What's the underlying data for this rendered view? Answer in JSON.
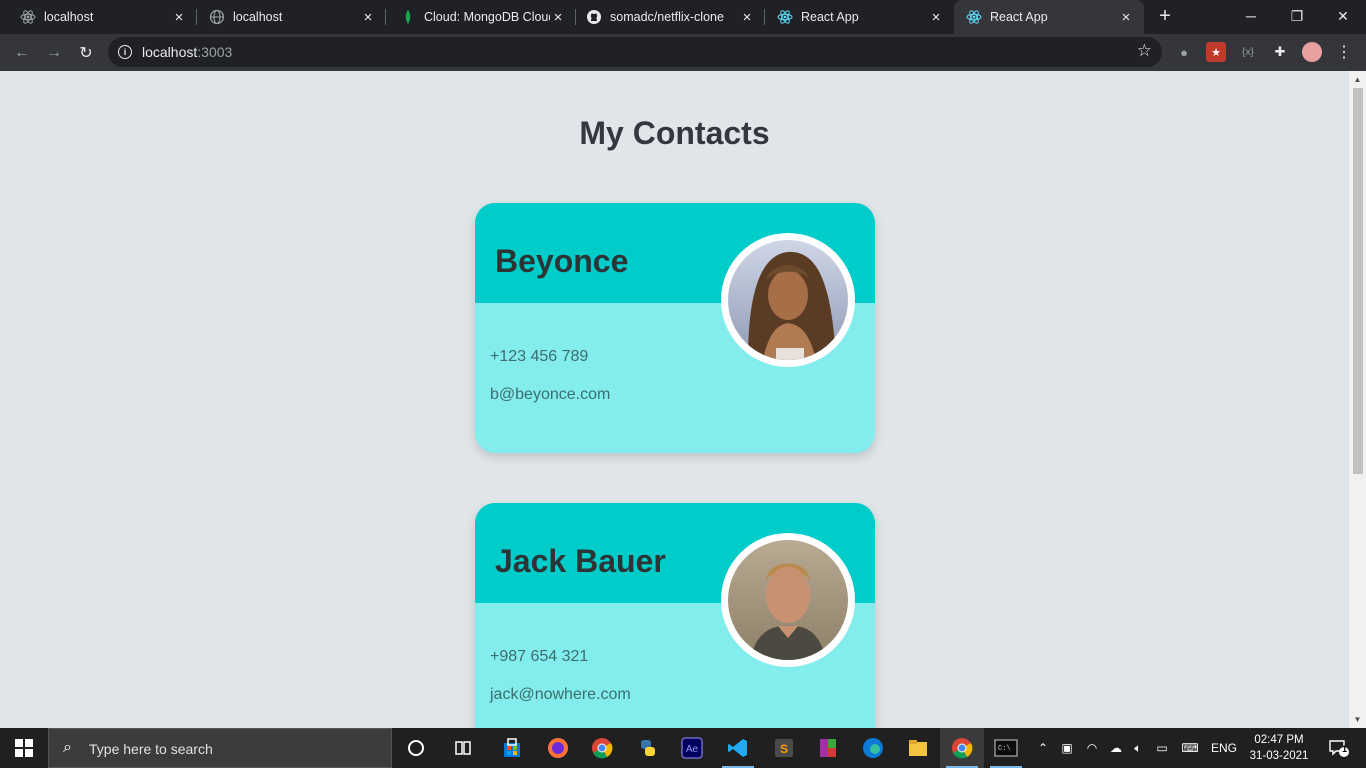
{
  "browser": {
    "tabs": [
      {
        "label": "localhost",
        "icon": "react-icon"
      },
      {
        "label": "localhost",
        "icon": "globe-icon"
      },
      {
        "label": "Cloud: MongoDB Cloud",
        "icon": "mongodb-leaf-icon"
      },
      {
        "label": "somadc/netflix-clone",
        "icon": "github-icon"
      },
      {
        "label": "React App",
        "icon": "react-icon"
      },
      {
        "label": "React App",
        "icon": "react-icon"
      }
    ],
    "active_tab_index": 5,
    "url_host": "localhost",
    "url_port": ":3003"
  },
  "page": {
    "title": "My Contacts",
    "contacts": [
      {
        "name": "Beyonce",
        "phone": "+123 456 789",
        "email": "b@beyonce.com",
        "avatar": "beyonce-photo"
      },
      {
        "name": "Jack Bauer",
        "phone": "+987 654 321",
        "email": "jack@nowhere.com",
        "avatar": "jack-bauer-photo"
      }
    ],
    "colors": {
      "card_header": "#00ccc9",
      "card_body": "#83ecec",
      "background": "#dfe5e8"
    }
  },
  "taskbar": {
    "search_placeholder": "Type here to search",
    "language": "ENG",
    "time": "02:47 PM",
    "date": "31-03-2021",
    "notification_count": "1"
  }
}
